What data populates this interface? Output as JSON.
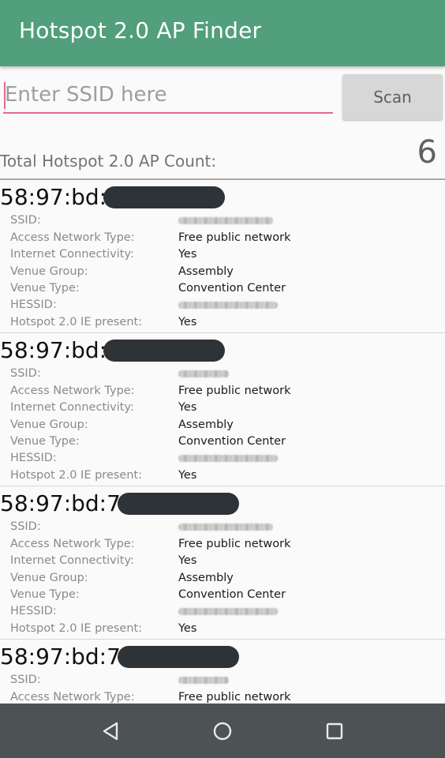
{
  "app": {
    "title": "Hotspot 2.0 AP Finder",
    "accent_color": "#519f7b",
    "input_accent_color": "#e06a8e"
  },
  "search": {
    "placeholder": "Enter SSID here",
    "value": "",
    "scan_label": "Scan"
  },
  "summary": {
    "label": "Total Hotspot 2.0 AP Count:",
    "count": "6"
  },
  "labels": {
    "ssid": "SSID:",
    "access_network_type": "Access Network Type:",
    "internet_connectivity": "Internet Connectivity:",
    "venue_group": "Venue Group:",
    "venue_type": "Venue Type:",
    "hessid": "HESSID:",
    "hs20_present": "Hotspot 2.0 IE present:"
  },
  "aps": [
    {
      "bssid_prefix": "58:97:bd:",
      "access_network_type": "Free public network",
      "internet_connectivity": "Yes",
      "venue_group": "Assembly",
      "venue_type": "Convention Center",
      "hs20_present": "Yes"
    },
    {
      "bssid_prefix": "58:97:bd:",
      "access_network_type": "Free public network",
      "internet_connectivity": "Yes",
      "venue_group": "Assembly",
      "venue_type": "Convention Center",
      "hs20_present": "Yes"
    },
    {
      "bssid_prefix": "58:97:bd:7",
      "access_network_type": "Free public network",
      "internet_connectivity": "Yes",
      "venue_group": "Assembly",
      "venue_type": "Convention Center",
      "hs20_present": "Yes"
    },
    {
      "bssid_prefix": "58:97:bd:7",
      "access_network_type": "Free public network"
    }
  ],
  "navbar": {
    "back_icon": "back-triangle-icon",
    "home_icon": "home-circle-icon",
    "recents_icon": "recents-square-icon"
  }
}
